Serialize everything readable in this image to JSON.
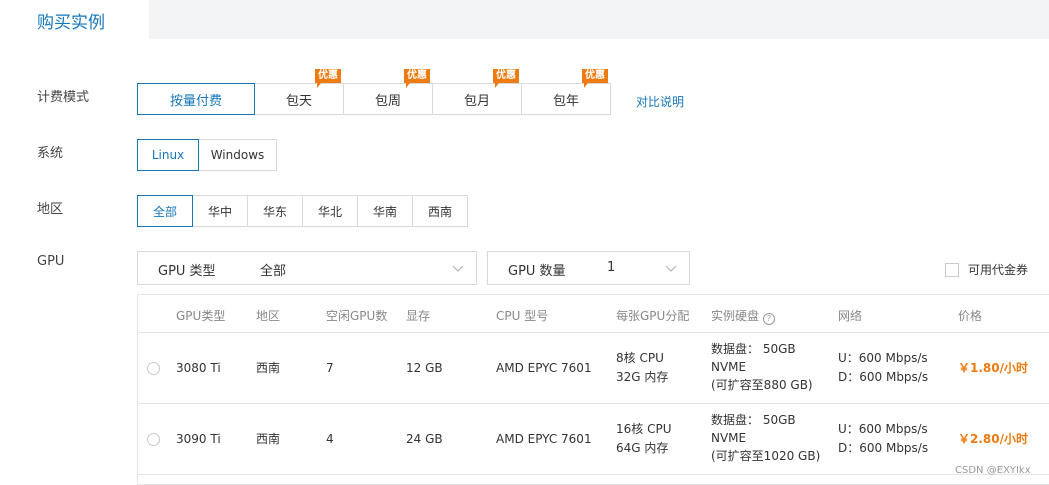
{
  "header": {
    "tab_title": "购买实例"
  },
  "billing": {
    "label": "计费模式",
    "options": [
      "按量付费",
      "包天",
      "包周",
      "包月",
      "包年"
    ],
    "badge": "优惠",
    "compare_link": "对比说明"
  },
  "system": {
    "label": "系统",
    "options": [
      "Linux",
      "Windows"
    ]
  },
  "region": {
    "label": "地区",
    "options": [
      "全部",
      "华中",
      "华东",
      "华北",
      "华南",
      "西南"
    ]
  },
  "gpu": {
    "label": "GPU",
    "type_select": {
      "label": "GPU 类型",
      "value": "全部"
    },
    "count_select": {
      "label": "GPU 数量",
      "value": "1"
    },
    "voucher_label": "可用代金券"
  },
  "table": {
    "headers": [
      "GPU类型",
      "地区",
      "空闲GPU数",
      "显存",
      "CPU 型号",
      "每张GPU分配",
      "实例硬盘",
      "网络",
      "价格"
    ],
    "rows": [
      {
        "gpu_type": "3080 Ti",
        "region": "西南",
        "free_gpus": "7",
        "vram": "12 GB",
        "cpu_model": "AMD EPYC 7601",
        "alloc_cpu": "8核 CPU",
        "alloc_mem": "32G 内存",
        "disk_1": "数据盘： 50GB",
        "disk_2": "NVME",
        "disk_3": "(可扩容至880 GB)",
        "net_up": "U：600 Mbps/s",
        "net_down": "D：600 Mbps/s",
        "price": "￥1.80/小时"
      },
      {
        "gpu_type": "3090 Ti",
        "region": "西南",
        "free_gpus": "4",
        "vram": "24 GB",
        "cpu_model": "AMD EPYC 7601",
        "alloc_cpu": "16核 CPU",
        "alloc_mem": "64G 内存",
        "disk_1": "数据盘： 50GB",
        "disk_2": "NVME",
        "disk_3": "(可扩容至1020 GB)",
        "net_up": "U：600 Mbps/s",
        "net_down": "D：600 Mbps/s",
        "price": "￥2.80/小时"
      }
    ]
  },
  "colors": {
    "accent": "#1677b8",
    "badge": "#ee7b12",
    "price": "#ee7b12"
  },
  "watermark": "CSDN @EXYIkx"
}
